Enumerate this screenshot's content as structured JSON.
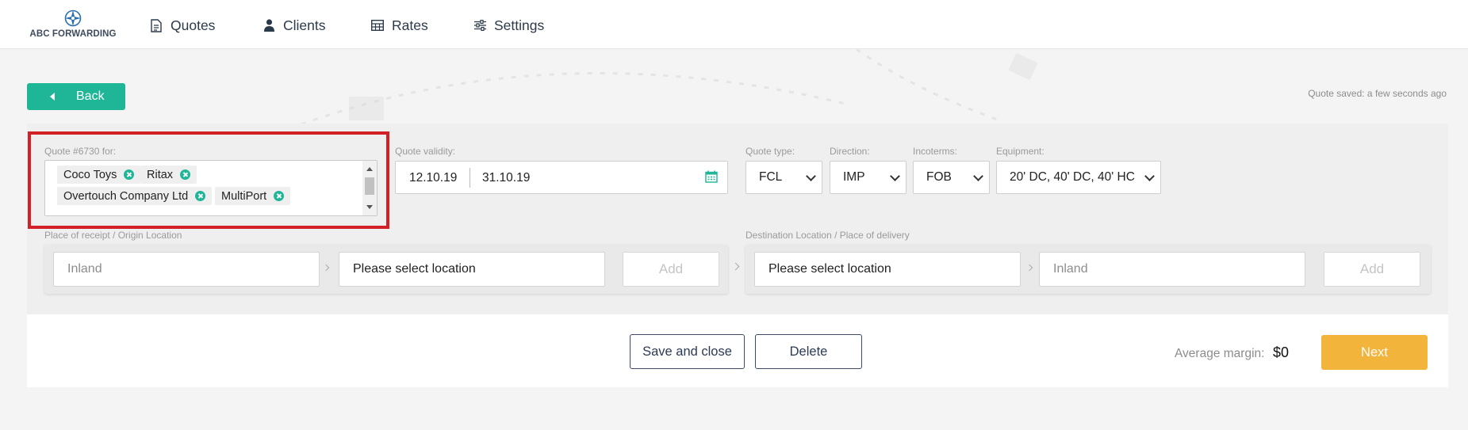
{
  "brand": {
    "name": "ABC FORWARDING",
    "logo_icon": "compass-logo-icon"
  },
  "nav": [
    {
      "label": "Quotes",
      "icon": "document-icon"
    },
    {
      "label": "Clients",
      "icon": "user-icon"
    },
    {
      "label": "Rates",
      "icon": "table-icon"
    },
    {
      "label": "Settings",
      "icon": "sliders-icon"
    }
  ],
  "back_button": {
    "label": "Back",
    "icon": "caret-left-icon"
  },
  "saved_status": "Quote saved: a few seconds ago",
  "quote": {
    "for_label": "Quote #6730 for:",
    "clients": [
      "Coco Toys",
      "Ritax",
      "Overtouch Company Ltd",
      "MultiPort"
    ]
  },
  "validity": {
    "label": "Quote validity:",
    "from": "12.10.19",
    "to": "31.10.19",
    "icon": "calendar-icon"
  },
  "quote_type": {
    "label": "Quote type:",
    "value": "FCL"
  },
  "direction": {
    "label": "Direction:",
    "value": "IMP"
  },
  "incoterms": {
    "label": "Incoterms:",
    "value": "FOB"
  },
  "equipment": {
    "label": "Equipment:",
    "value": "20' DC, 40' DC, 40' HC"
  },
  "origin": {
    "label": "Place of receipt / Origin Location",
    "inland_placeholder": "Inland",
    "location_placeholder": "Please select location",
    "add_label": "Add"
  },
  "destination": {
    "label": "Destination Location / Place of delivery",
    "location_placeholder": "Please select location",
    "inland_placeholder": "Inland",
    "add_label": "Add"
  },
  "footer": {
    "save_close_label": "Save and close",
    "delete_label": "Delete",
    "avg_margin_label": "Average margin:",
    "avg_margin_value": "$0",
    "next_label": "Next"
  },
  "colors": {
    "accent": "#1fb597",
    "next": "#f2b43a",
    "highlight": "#d32027",
    "navy": "#2b3a55"
  }
}
